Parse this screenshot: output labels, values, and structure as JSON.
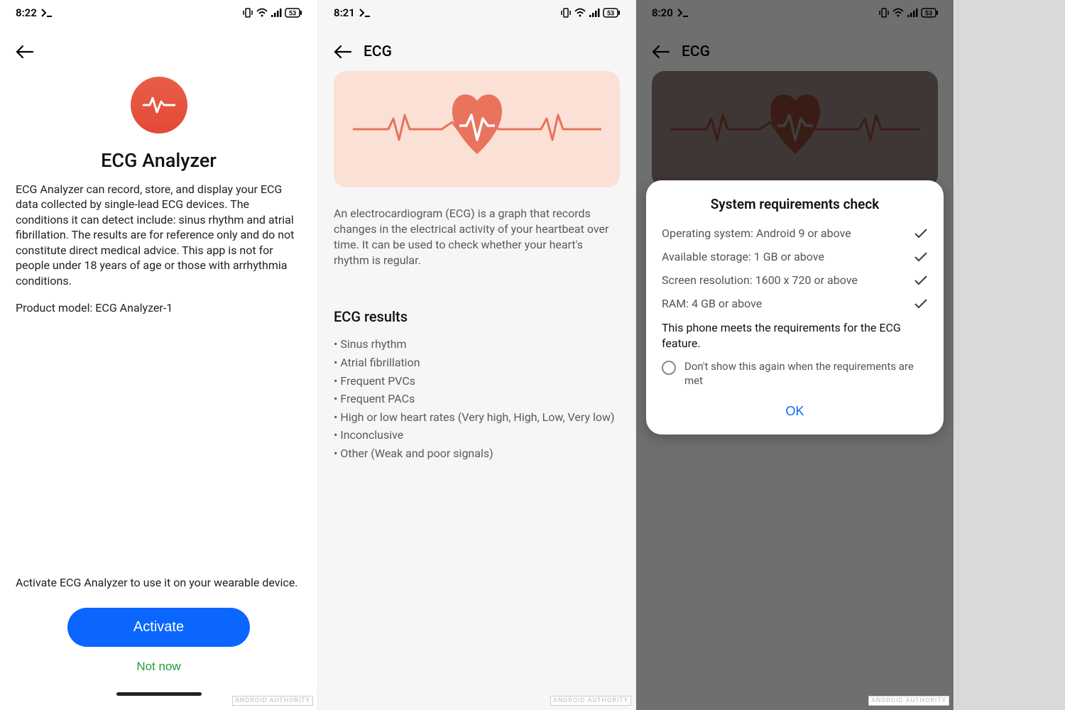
{
  "statusbar": {
    "battery": "53",
    "screens": [
      {
        "time": "8:22"
      },
      {
        "time": "8:21"
      },
      {
        "time": "8:20"
      }
    ]
  },
  "screen1": {
    "title": "ECG Analyzer",
    "description": "ECG Analyzer can record, store, and display your ECG data collected by single-lead ECG devices. The conditions it can detect include: sinus rhythm and atrial fibrillation. The results are for reference only and do not constitute direct medical advice. This app is not for people under 18 years of age or those with arrhythmia conditions.",
    "product_model": "Product model: ECG Analyzer-1",
    "prompt": "Activate ECG Analyzer to use it on your wearable device.",
    "activate_label": "Activate",
    "notnow_label": "Not now"
  },
  "screen2": {
    "header_title": "ECG",
    "description": "An electrocardiogram (ECG) is a graph that records changes in the electrical activity of your heartbeat over time. It can be used to check whether your heart's rhythm is regular.",
    "results_title": "ECG results",
    "results": [
      "Sinus rhythm",
      "Atrial fibrillation",
      "Frequent PVCs",
      "Frequent PACs",
      "High or low heart rates (Very high, High, Low, Very low)",
      "Inconclusive",
      "Other (Weak and poor signals)"
    ]
  },
  "screen3": {
    "header_title": "ECG",
    "dialog": {
      "title": "System requirements check",
      "requirements": [
        "Operating system: Android 9 or above",
        "Available storage: 1 GB or above",
        "Screen resolution: 1600 x 720 or above",
        "RAM: 4 GB or above"
      ],
      "summary": "This phone meets the requirements for the ECG feature.",
      "dont_show_label": "Don't show this again when the requirements are met",
      "ok_label": "OK"
    }
  },
  "watermark": "ANDROID AUTHORITY"
}
